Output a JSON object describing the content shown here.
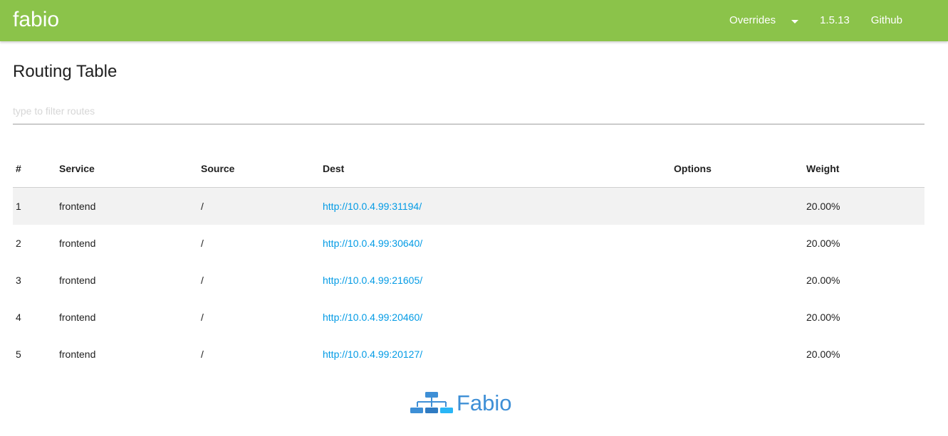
{
  "nav": {
    "brand": "fabio",
    "overrides": "Overrides",
    "version": "1.5.13",
    "github": "Github"
  },
  "page": {
    "title": "Routing Table",
    "filter_placeholder": "type to filter routes"
  },
  "table": {
    "headers": [
      "#",
      "Service",
      "Source",
      "Dest",
      "Options",
      "Weight"
    ],
    "rows": [
      {
        "num": "1",
        "service": "frontend",
        "source": "/",
        "dest": "http://10.0.4.99:31194/",
        "options": "",
        "weight": "20.00%"
      },
      {
        "num": "2",
        "service": "frontend",
        "source": "/",
        "dest": "http://10.0.4.99:30640/",
        "options": "",
        "weight": "20.00%"
      },
      {
        "num": "3",
        "service": "frontend",
        "source": "/",
        "dest": "http://10.0.4.99:21605/",
        "options": "",
        "weight": "20.00%"
      },
      {
        "num": "4",
        "service": "frontend",
        "source": "/",
        "dest": "http://10.0.4.99:20460/",
        "options": "",
        "weight": "20.00%"
      },
      {
        "num": "5",
        "service": "frontend",
        "source": "/",
        "dest": "http://10.0.4.99:20127/",
        "options": "",
        "weight": "20.00%"
      }
    ]
  },
  "footer": {
    "logo_text": "Fabio",
    "logo_icon": "network-tree-icon"
  },
  "colors": {
    "navbar": "#8bc34a",
    "link": "#039be5",
    "logo": "#3e8fd6"
  }
}
